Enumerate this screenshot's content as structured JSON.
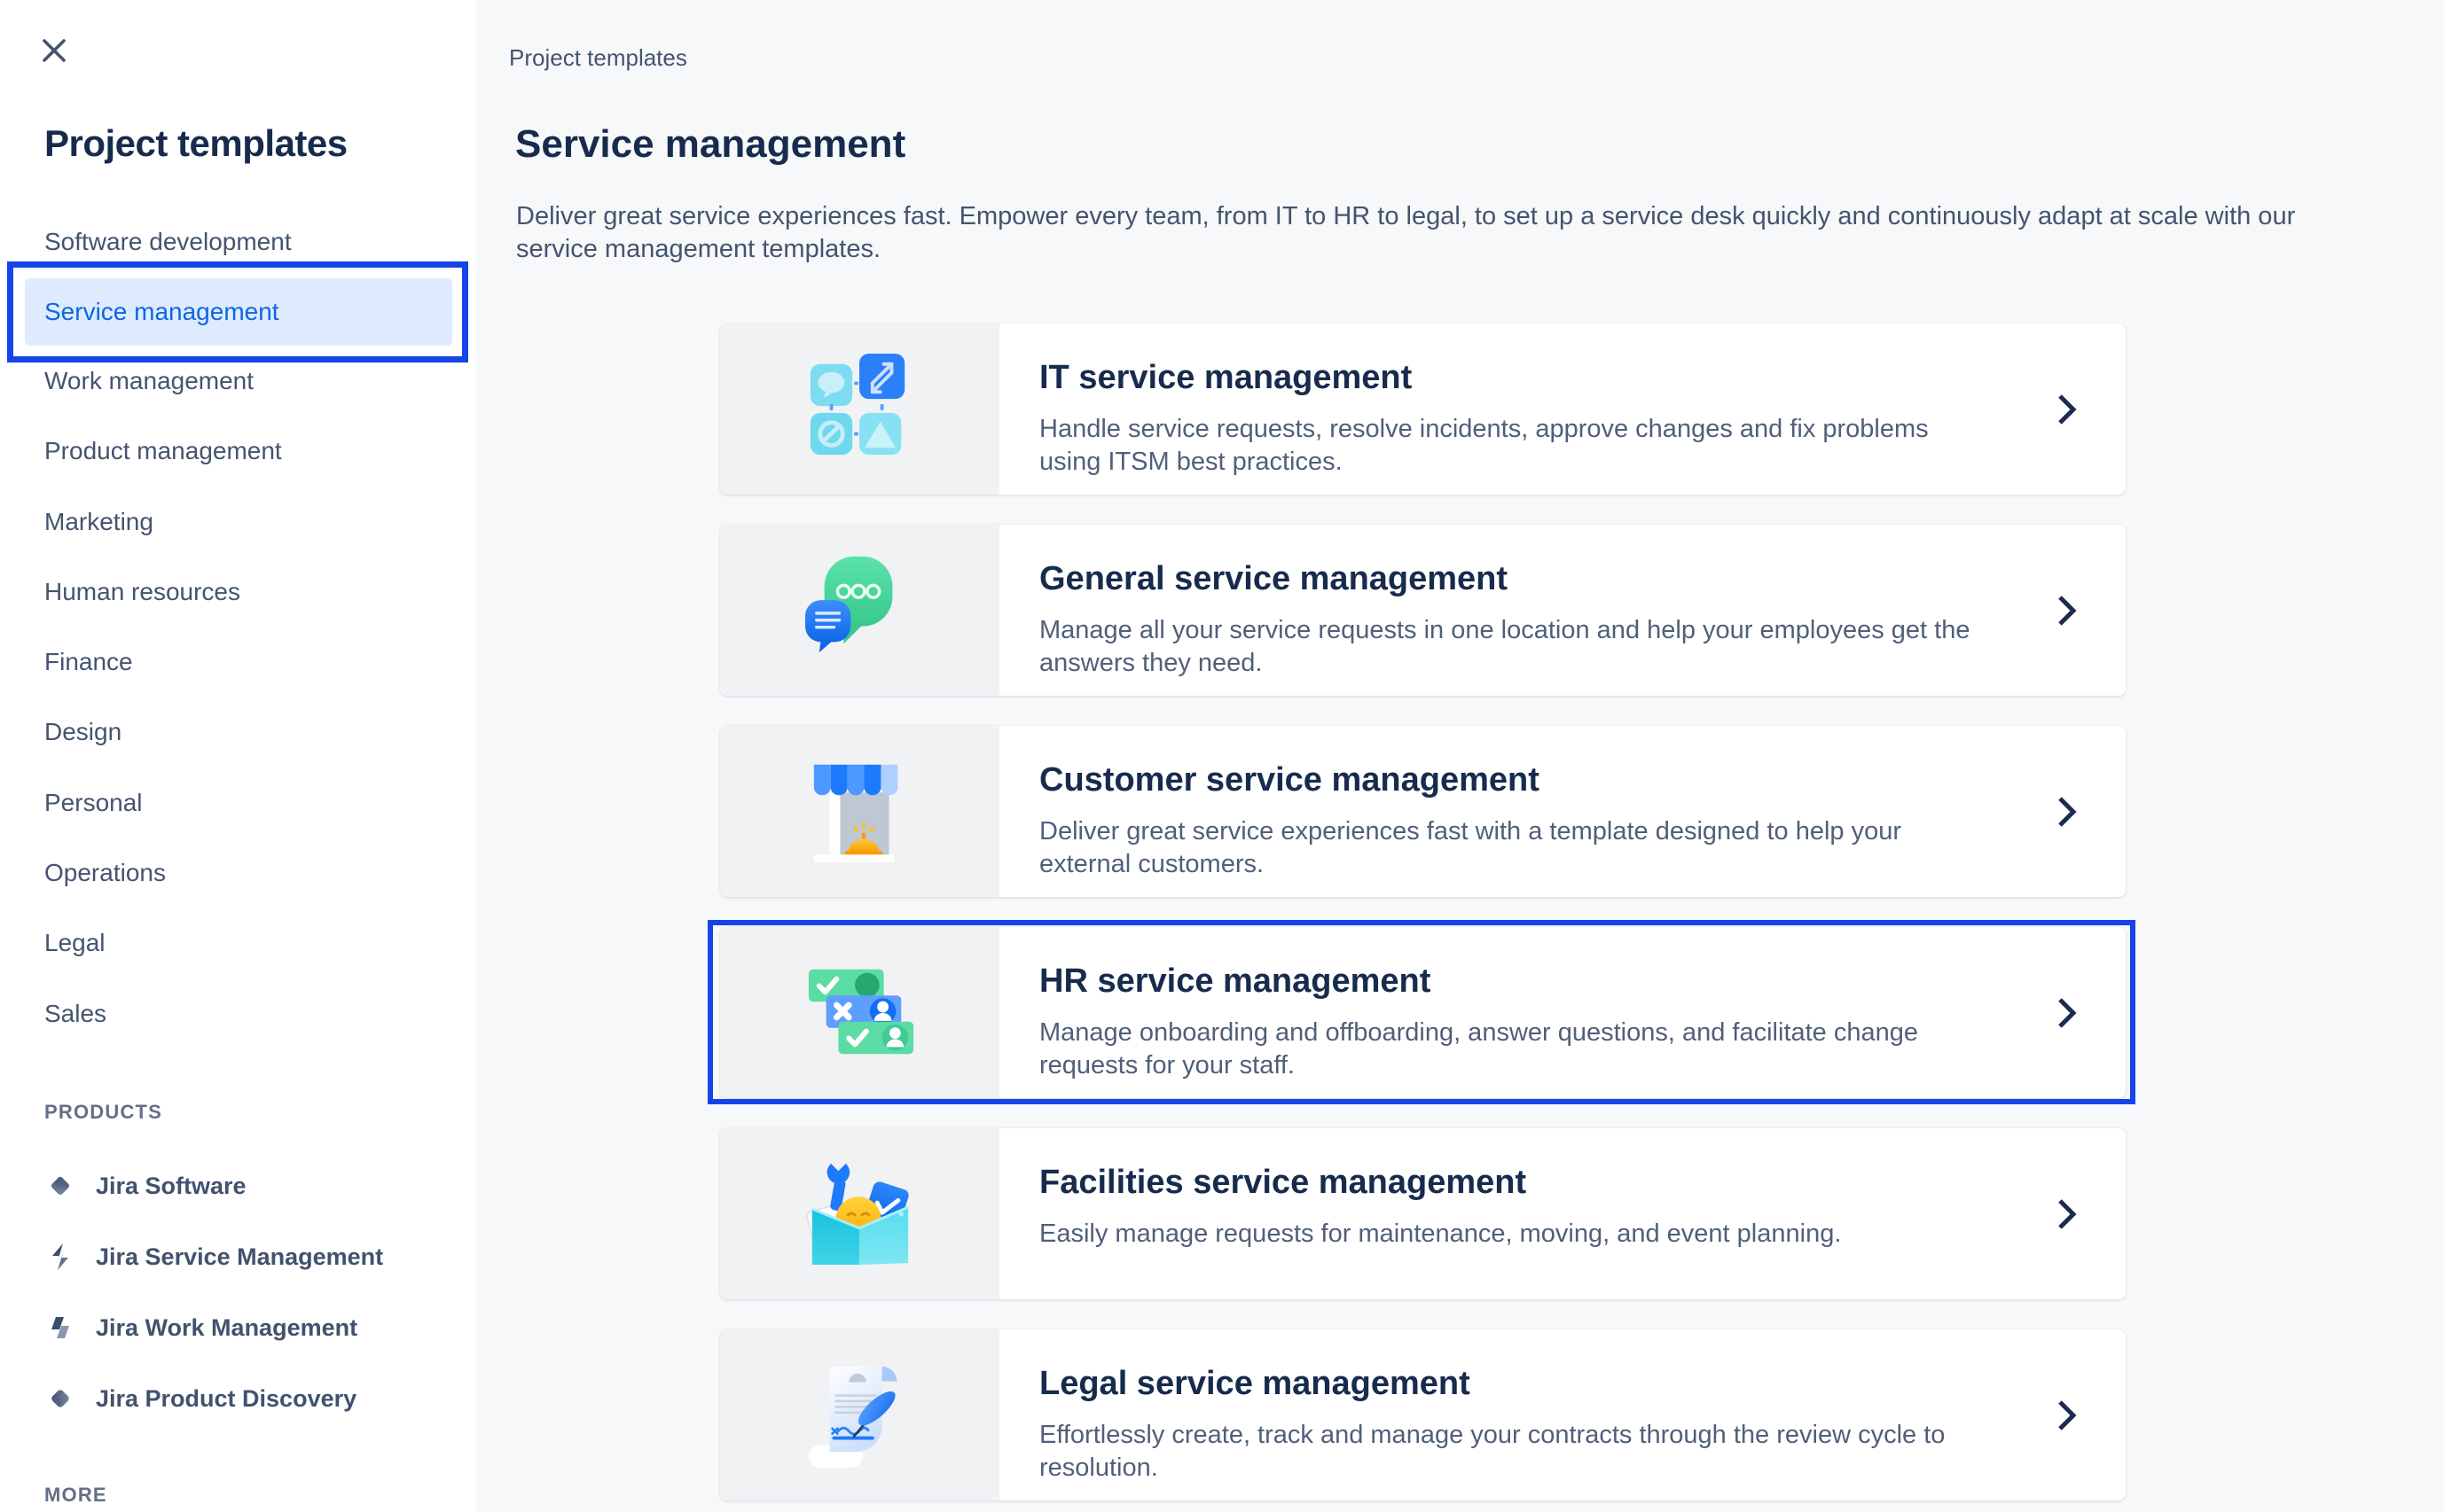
{
  "sidebar": {
    "title": "Project templates",
    "categories": [
      {
        "label": "Software development"
      },
      {
        "label": "Service management"
      },
      {
        "label": "Work management"
      },
      {
        "label": "Product management"
      },
      {
        "label": "Marketing"
      },
      {
        "label": "Human resources"
      },
      {
        "label": "Finance"
      },
      {
        "label": "Design"
      },
      {
        "label": "Personal"
      },
      {
        "label": "Operations"
      },
      {
        "label": "Legal"
      },
      {
        "label": "Sales"
      }
    ],
    "selected_category": "Service management",
    "products_header": "PRODUCTS",
    "products": [
      {
        "label": "Jira Software",
        "icon": "jira-software-logo"
      },
      {
        "label": "Jira Service Management",
        "icon": "jira-service-management-logo"
      },
      {
        "label": "Jira Work Management",
        "icon": "jira-work-management-logo"
      },
      {
        "label": "Jira Product Discovery",
        "icon": "jira-product-discovery-logo"
      }
    ],
    "more_header": "MORE"
  },
  "main": {
    "breadcrumb": "Project templates",
    "title": "Service management",
    "description": "Deliver great service experiences fast. Empower every team, from IT to HR to legal, to set up a service desk quickly and continuously adapt at scale with our service management templates.",
    "templates": [
      {
        "title": "IT service management",
        "description": "Handle service requests, resolve incidents, approve changes and fix problems using ITSM best practices.",
        "icon": "it-service-management-illustration",
        "highlighted": false
      },
      {
        "title": "General service management",
        "description": "Manage all your service requests in one location and help your employees get the answers they need.",
        "icon": "general-service-management-illustration",
        "highlighted": false
      },
      {
        "title": "Customer service management",
        "description": "Deliver great service experiences fast with a template designed to help your external customers.",
        "icon": "customer-service-management-illustration",
        "highlighted": false
      },
      {
        "title": "HR service management",
        "description": "Manage onboarding and offboarding, answer questions, and facilitate change requests for your staff.",
        "icon": "hr-service-management-illustration",
        "highlighted": true
      },
      {
        "title": "Facilities service management",
        "description": "Easily manage requests for maintenance, moving, and event planning.",
        "icon": "facilities-service-management-illustration",
        "highlighted": false
      },
      {
        "title": "Legal service management",
        "description": "Effortlessly create, track and manage your contracts through the review cycle to resolution.",
        "icon": "legal-service-management-illustration",
        "highlighted": false
      }
    ]
  },
  "colors": {
    "annotation_highlight": "#1744E8",
    "selected_item_bg": "#DEEBFF",
    "selected_item_text": "#0C66E4",
    "heading_text": "#172B4D",
    "body_text": "#44546F",
    "main_bg": "#F7F8FA",
    "card_iconzone_bg": "#F1F2F4"
  }
}
